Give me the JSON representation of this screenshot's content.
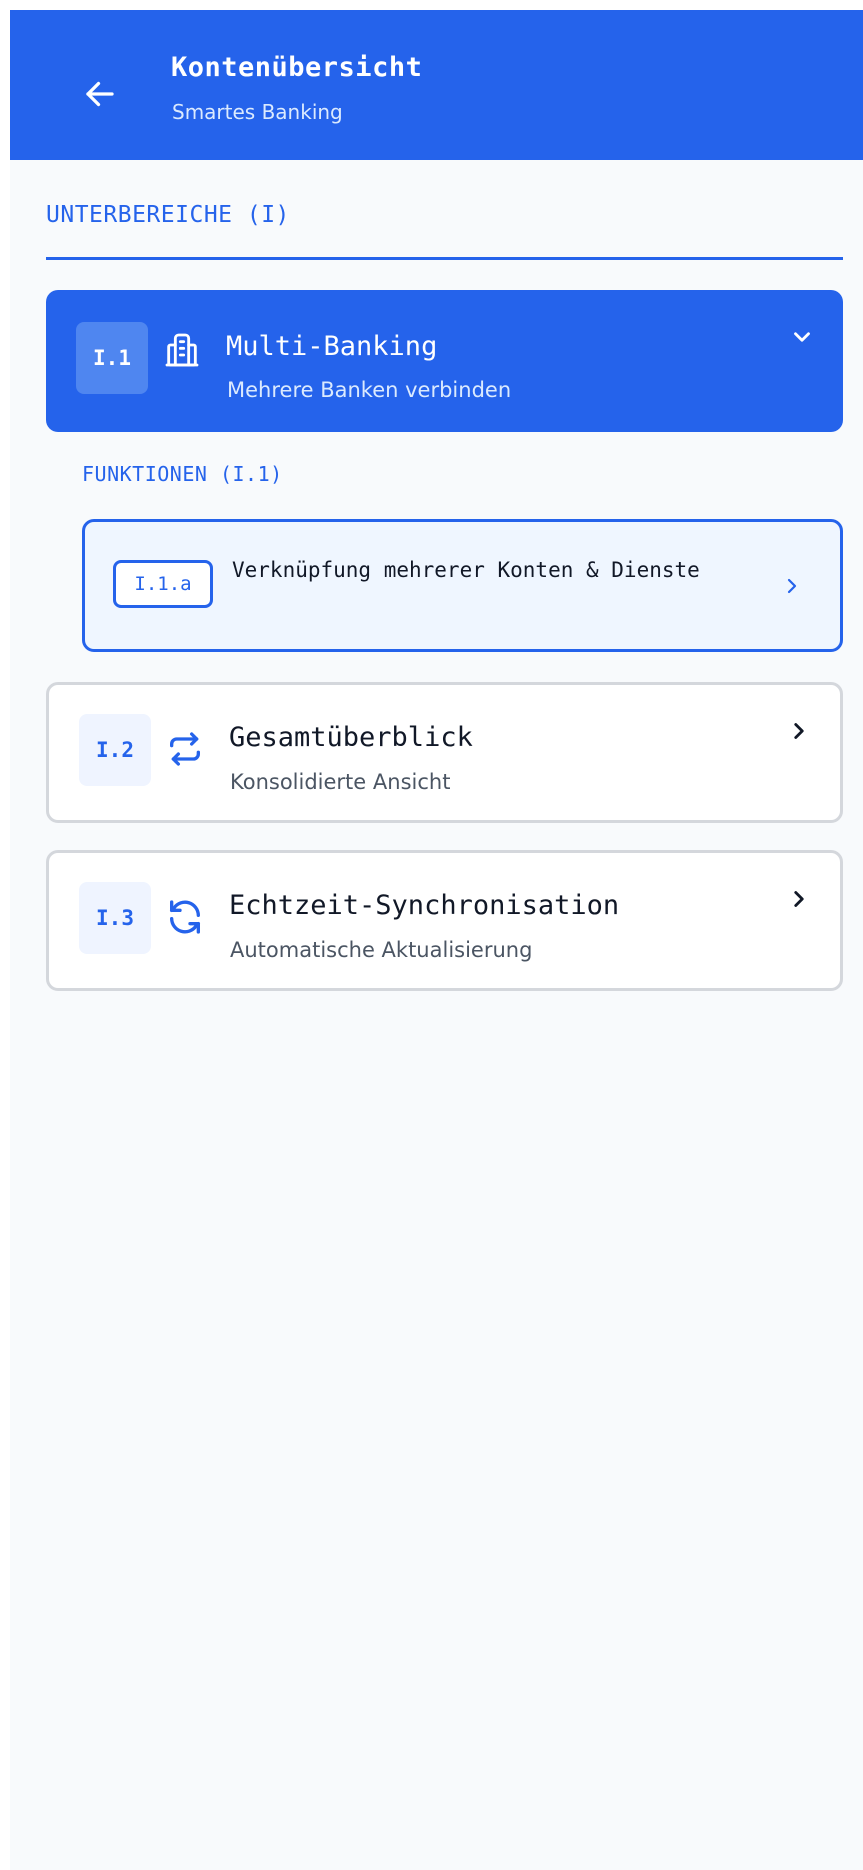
{
  "header": {
    "title": "Kontenübersicht",
    "subtitle": "Smartes Banking",
    "back_icon": "arrow-left-icon",
    "background_color": "#2563eb"
  },
  "section": {
    "title": "UNTERBEREICHE (I)"
  },
  "items": [
    {
      "code": "I.1",
      "icon": "bank-document-icon",
      "title": "Multi-Banking",
      "subtitle": "Mehrere Banken verbinden",
      "expanded": true,
      "chevron": "chevron-down-icon"
    },
    {
      "code": "I.2",
      "icon": "arrows-exchange-icon",
      "title": "Gesamtüberblick",
      "subtitle": "Konsolidierte Ansicht",
      "expanded": false,
      "chevron": "chevron-right-icon"
    },
    {
      "code": "I.3",
      "icon": "sync-icon",
      "title": "Echtzeit-Synchronisation",
      "subtitle": "Automatische Aktualisierung",
      "expanded": false,
      "chevron": "chevron-right-icon"
    }
  ],
  "subsection": {
    "title": "FUNKTIONEN (I.1)",
    "features": [
      {
        "code": "I.1.a",
        "label": "Verknüpfung mehrerer Konten & Dienste",
        "chevron": "chevron-right-icon"
      }
    ]
  },
  "colors": {
    "accent": "#2563eb",
    "background": "#f8fafc",
    "card_border": "#d4d7dc",
    "feature_background": "#eff6ff"
  }
}
